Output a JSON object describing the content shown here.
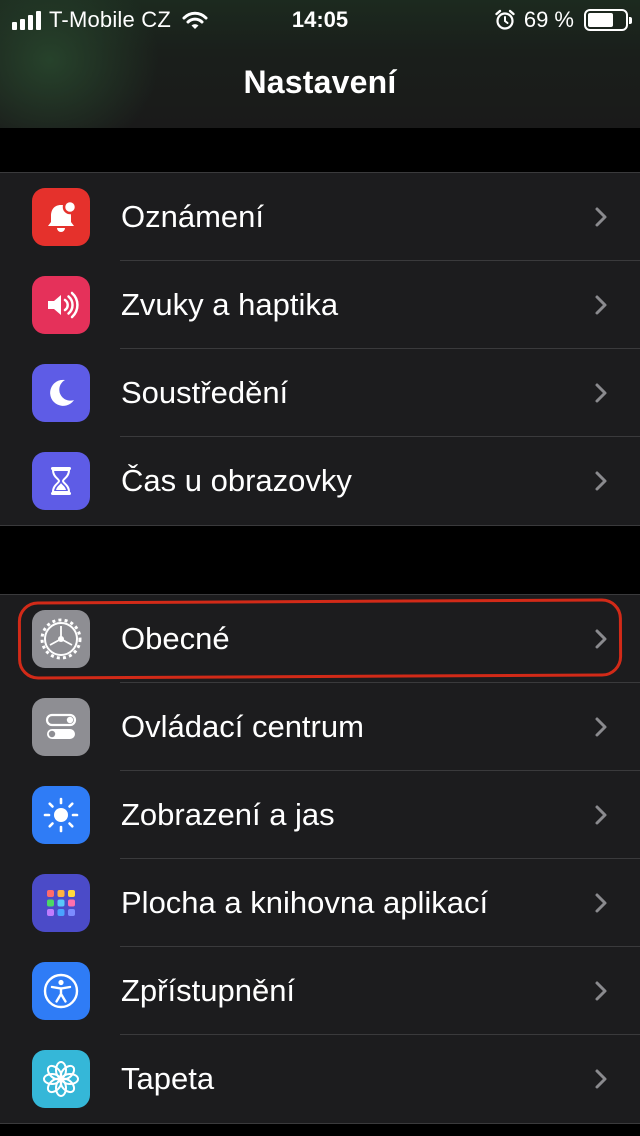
{
  "status_bar": {
    "carrier": "T-Mobile CZ",
    "time": "14:05",
    "battery_text": "69 %",
    "battery_level": 0.69,
    "icons": [
      "signal-icon",
      "wifi-icon",
      "alarm-icon",
      "battery-icon"
    ]
  },
  "nav": {
    "title": "Nastavení"
  },
  "groups": [
    {
      "items": [
        {
          "label": "Oznámení",
          "icon": "notifications-icon",
          "color": "#e5312c"
        },
        {
          "label": "Zvuky a haptika",
          "icon": "sounds-icon",
          "color": "#e5315a"
        },
        {
          "label": "Soustředění",
          "icon": "focus-moon-icon",
          "color": "#5e5ce6"
        },
        {
          "label": "Čas u obrazovky",
          "icon": "screen-time-hourglass-icon",
          "color": "#5e5ce6"
        }
      ]
    },
    {
      "items": [
        {
          "label": "Obecné",
          "icon": "gear-icon",
          "color": "#8e8e93"
        },
        {
          "label": "Ovládací centrum",
          "icon": "control-center-toggles-icon",
          "color": "#8e8e93"
        },
        {
          "label": "Zobrazení a jas",
          "icon": "display-sun-icon",
          "color": "#2f7cf6"
        },
        {
          "label": "Plocha a knihovna aplikací",
          "icon": "home-screen-grid-icon",
          "color": "#5b5bd6"
        },
        {
          "label": "Zpřístupnění",
          "icon": "accessibility-icon",
          "color": "#2f7cf6"
        },
        {
          "label": "Tapeta",
          "icon": "wallpaper-flower-icon",
          "color": "#35b7d8"
        }
      ]
    }
  ],
  "highlight": {
    "target": "Obecné",
    "color": "#d22a18"
  }
}
